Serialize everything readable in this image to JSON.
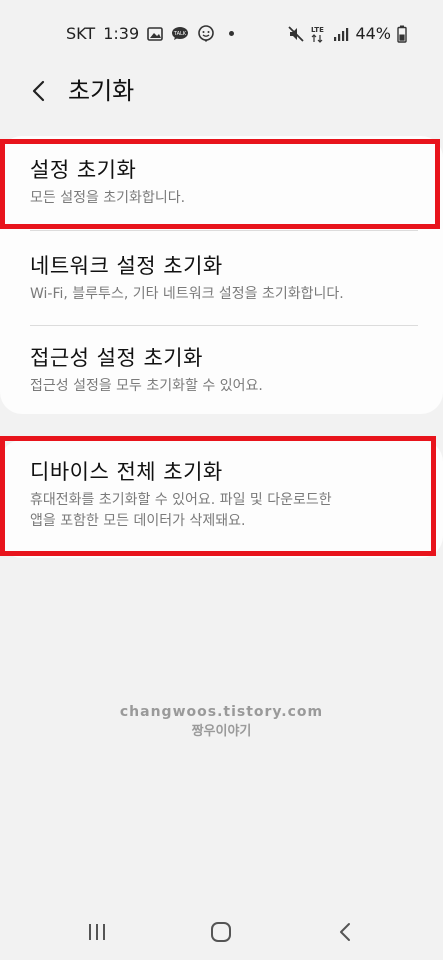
{
  "status_bar": {
    "carrier": "SKT",
    "time": "1:39",
    "network": "LTE",
    "battery": "44%"
  },
  "header": {
    "title": "초기화",
    "back_icon": "chevron-left-icon"
  },
  "items": [
    {
      "title": "설정 초기화",
      "desc": "모든 설정을 초기화합니다."
    },
    {
      "title": "네트워크 설정 초기화",
      "desc": "Wi-Fi, 블루투스, 기타 네트워크 설정을 초기화합니다."
    },
    {
      "title": "접근성 설정 초기화",
      "desc": "접근성 설정을 모두 초기화할 수 있어요."
    },
    {
      "title": "디바이스 전체 초기화",
      "desc_line1": "휴대전화를 초기화할 수 있어요. 파일 및 다운로드한",
      "desc_line2": "앱을 포함한 모든 데이터가 삭제돼요."
    }
  ],
  "watermark": {
    "line1": "changwoos.tistory.com",
    "line2": "짱우이야기"
  },
  "colors": {
    "background": "#f2f2f2",
    "card": "#fdfdfd",
    "highlight": "#e8141c"
  }
}
